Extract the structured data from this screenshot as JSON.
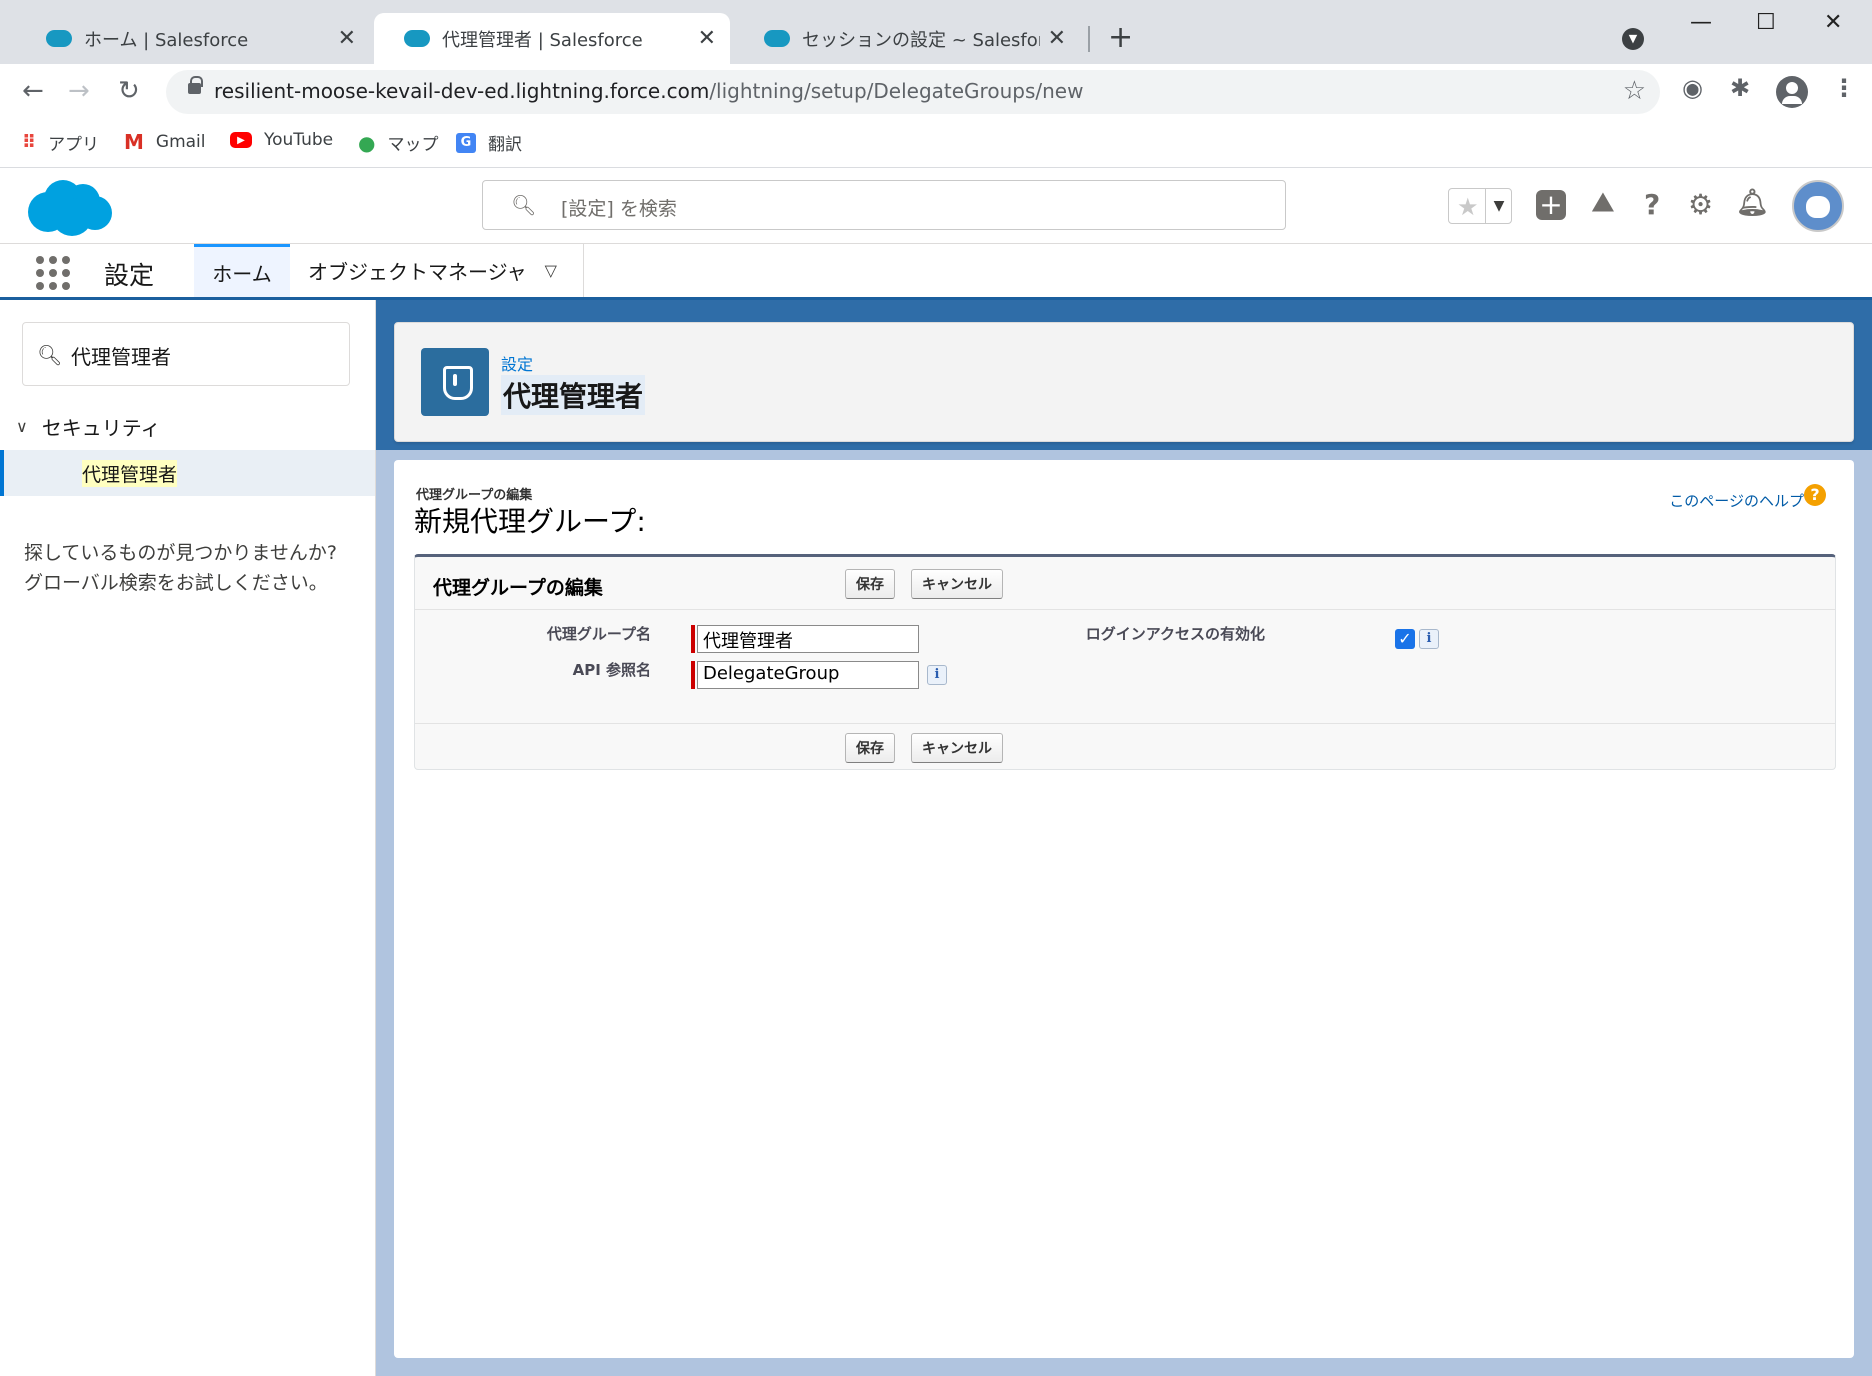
{
  "browser": {
    "tabs": [
      {
        "label": "ホーム | Salesforce",
        "active": false
      },
      {
        "label": "代理管理者 | Salesforce",
        "active": true
      },
      {
        "label": "セッションの設定 ~ Salesforce - Dev",
        "active": false
      }
    ],
    "url_host": "resilient-moose-kevail-dev-ed.lightning.force.com",
    "url_path": "/lightning/setup/DelegateGroups/new",
    "bookmarks": [
      {
        "label": "アプリ",
        "icon": "apps-grid-icon"
      },
      {
        "label": "Gmail",
        "icon": "gmail-icon"
      },
      {
        "label": "YouTube",
        "icon": "youtube-icon"
      },
      {
        "label": "マップ",
        "icon": "maps-pin-icon"
      },
      {
        "label": "翻訳",
        "icon": "translate-icon"
      }
    ]
  },
  "sf_header": {
    "search_placeholder": "[設定] を検索"
  },
  "app_nav": {
    "app_name": "設定",
    "tabs": [
      {
        "label": "ホーム",
        "active": true
      },
      {
        "label": "オブジェクトマネージャ",
        "active": false
      }
    ]
  },
  "sidebar": {
    "quick_find_value": "代理管理者",
    "tree_node": "セキュリティ",
    "tree_leaf": "代理管理者",
    "not_found_line1": "探しているものが見つかりませんか?",
    "not_found_line2": "グローバル検索をお試しください。"
  },
  "page_header": {
    "breadcrumb": "設定",
    "title": "代理管理者"
  },
  "main": {
    "subtitle": "代理グループの編集",
    "title": "新規代理グループ:",
    "help_link": "このページのヘルプ",
    "help_icon": "?",
    "block_title": "代理グループの編集",
    "save_label": "保存",
    "cancel_label": "キャンセル",
    "fields": {
      "group_name_label": "代理グループ名",
      "group_name_value": "代理管理者",
      "api_name_label": "API 参照名",
      "api_name_value": "DelegateGroup",
      "login_access_label": "ログインアクセスの有効化",
      "login_access_checked": true
    },
    "info_icon": "i"
  }
}
